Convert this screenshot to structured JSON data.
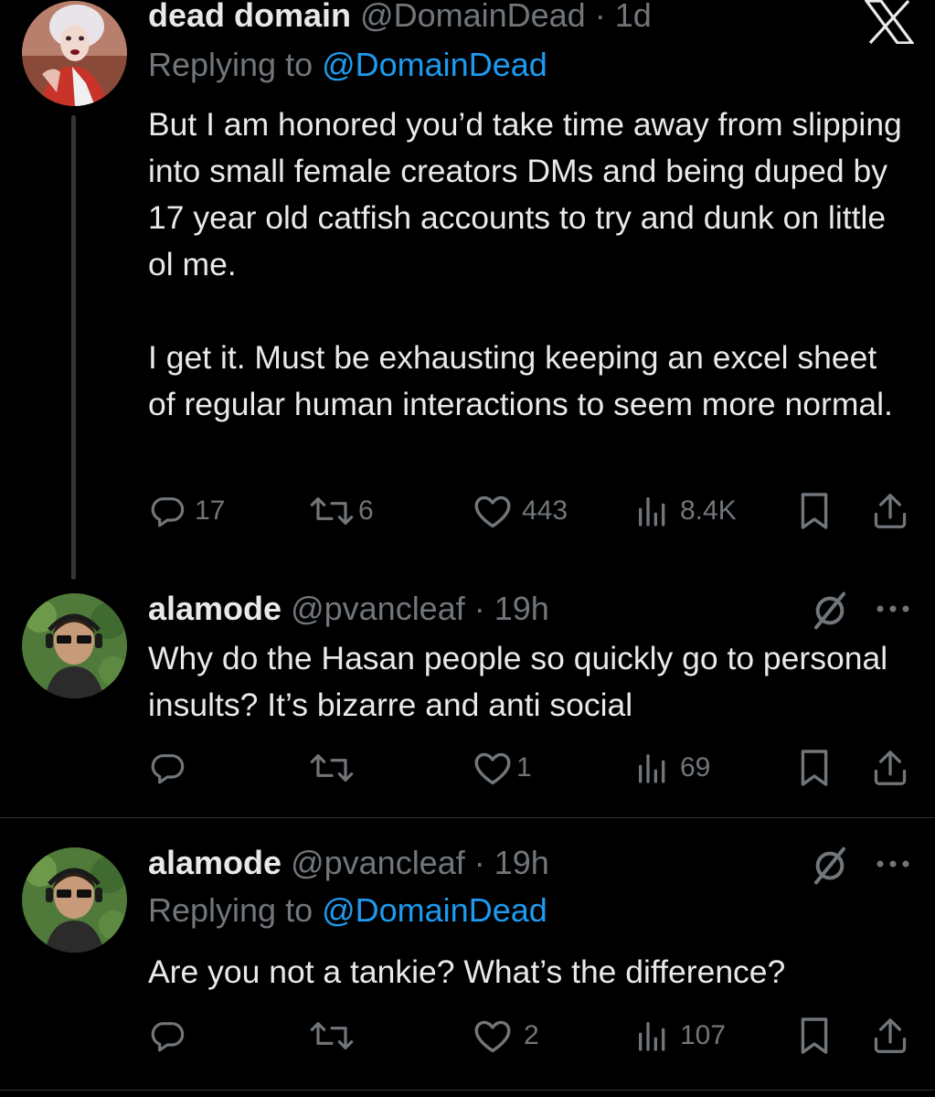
{
  "tweets": [
    {
      "name": "dead domain",
      "handle": "@DomainDead",
      "time": "· 1d",
      "replying_prefix": "Replying to ",
      "replying_to": "@DomainDead",
      "paragraphs": [
        "But I am honored you’d take time away from slipping into small female creators DMs and being duped by 17 year old catfish accounts to try and dunk on little ol me.",
        "I get it. Must be exhausting keeping an excel sheet of regular human interactions to seem more normal."
      ],
      "counts": {
        "replies": "17",
        "reposts": "6",
        "likes": "443",
        "views": "8.4K"
      }
    },
    {
      "name": "alamode",
      "handle": "@pvancleaf",
      "time": "· 19h",
      "paragraphs": [
        "Why do the Hasan people so quickly go to personal insults? It’s bizarre and anti social"
      ],
      "counts": {
        "replies": "",
        "reposts": "",
        "likes": "1",
        "views": "69"
      }
    },
    {
      "name": "alamode",
      "handle": "@pvancleaf",
      "time": "· 19h",
      "replying_prefix": "Replying to ",
      "replying_to": "@DomainDead",
      "paragraphs": [
        "Are you not a tankie? What’s the difference?"
      ],
      "counts": {
        "replies": "",
        "reposts": "",
        "likes": "2",
        "views": "107"
      }
    }
  ],
  "icons": {
    "logo": "x-logo-icon",
    "reply": "reply-icon",
    "repost": "repost-icon",
    "like": "heart-icon",
    "views": "views-icon",
    "bookmark": "bookmark-icon",
    "share": "share-icon",
    "more": "more-icon",
    "muted": "muted-icon"
  },
  "colors": {
    "background": "#000000",
    "text": "#e7e9ea",
    "secondary": "#71767b",
    "accent": "#1d9bf0"
  }
}
